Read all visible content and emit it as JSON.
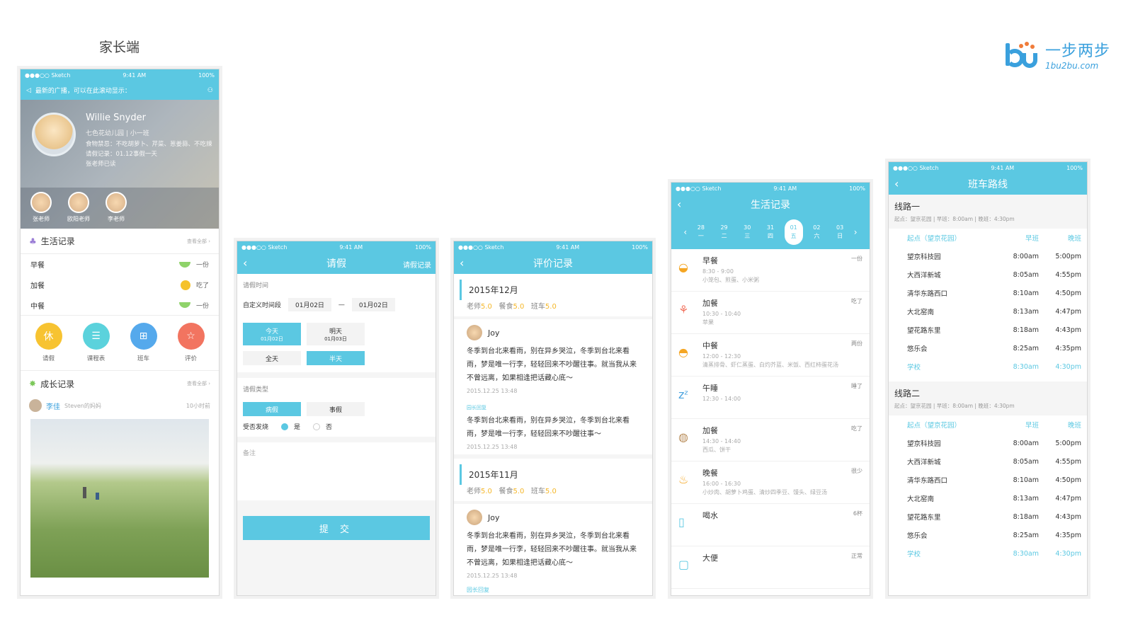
{
  "header": {
    "title": "家长端"
  },
  "logo": {
    "cn": "一步两步",
    "en": "1bu2bu.com"
  },
  "status": {
    "carrier": "●●●○○ Sketch",
    "time": "9:41 AM",
    "battery": "100%"
  },
  "p1": {
    "broadcast": "最新的广播，可以在此滚动显示：",
    "name": "Willie Snyder",
    "school": "七色花幼儿园  |  小一班",
    "info1": "食物禁忌：不吃胡萝卜、芹菜、葱姜蒜、不吃辣",
    "info2": "请假记录：01.12事假一天",
    "info3": "张老师已读",
    "teachers": [
      "张老师",
      "欧阳老师",
      "李老师"
    ],
    "life_title": "生活记录",
    "more": "查看全部",
    "meals": [
      {
        "name": "早餐",
        "status": "一份"
      },
      {
        "name": "加餐",
        "status": "吃了"
      },
      {
        "name": "中餐",
        "status": "一份"
      }
    ],
    "quick": [
      "请假",
      "课程表",
      "班车",
      "评价"
    ],
    "quick_icons": [
      "休",
      "☰",
      "⊞",
      "☆"
    ],
    "growth_title": "成长记录",
    "post_user": "李佳",
    "post_rel": "Steven的妈妈",
    "post_time": "10小时前"
  },
  "p2": {
    "title": "请假",
    "right": "请假记录",
    "time_label": "请假时间",
    "custom": "自定义时间段",
    "from": "01月02日",
    "dash": "—",
    "to": "01月02日",
    "today": "今天",
    "today_d": "01月02日",
    "tomorrow": "明天",
    "tomorrow_d": "01月03日",
    "full": "全天",
    "half": "半天",
    "type_label": "请假类型",
    "sick": "病假",
    "personal": "事假",
    "fever": "受否发烧",
    "yes": "是",
    "no": "否",
    "note": "备注",
    "submit": "提 交"
  },
  "p3": {
    "title": "评价记录",
    "blocks": [
      {
        "month": "2015年12月",
        "s1": "老师",
        "v1": "5.0",
        "s2": "餐食",
        "v2": "5.0",
        "s3": "班车",
        "v3": "5.0",
        "user": "Joy",
        "text": "冬季到台北来看雨，别在异乡哭泣，冬季到台北来看雨，梦是唯一行李，轻轻回来不吵醒往事。就当我从来不曾远离，如果相逢把话藏心底～",
        "date": "2015.12.25  13:48",
        "reply_label": "园长回复",
        "reply": "冬季到台北来看雨，别在异乡哭泣，冬季到台北来看雨，梦是唯一行李，轻轻回来不吵醒往事～",
        "reply_date": "2015.12.25  13:48"
      },
      {
        "month": "2015年11月",
        "s1": "老师",
        "v1": "5.0",
        "s2": "餐食",
        "v2": "5.0",
        "s3": "班车",
        "v3": "5.0",
        "user": "Joy",
        "text": "冬季到台北来看雨，别在异乡哭泣，冬季到台北来看雨，梦是唯一行李，轻轻回来不吵醒往事。就当我从来不曾远离，如果相逢把话藏心底～",
        "date": "2015.12.25  13:48",
        "reply_label": "园长回复"
      }
    ]
  },
  "p4": {
    "title": "生活记录",
    "days": [
      {
        "n": "28",
        "w": "一"
      },
      {
        "n": "29",
        "w": "二"
      },
      {
        "n": "30",
        "w": "三"
      },
      {
        "n": "31",
        "w": "四"
      },
      {
        "n": "01",
        "w": "五"
      },
      {
        "n": "02",
        "w": "六"
      },
      {
        "n": "03",
        "w": "日"
      }
    ],
    "items": [
      {
        "name": "早餐",
        "time": "8:30 - 9:00",
        "desc": "小笼包、煎蛋、小米粥",
        "status": "一份",
        "icon": "◒"
      },
      {
        "name": "加餐",
        "time": "10:30 - 10:40",
        "desc": "苹果",
        "status": "吃了",
        "icon": "⚘"
      },
      {
        "name": "中餐",
        "time": "12:00 - 12:30",
        "desc": "清蒸排骨、虾仁蒸蛋、白灼芥蓝、米饭、西红柿蛋花汤",
        "status": "两份",
        "icon": "◓"
      },
      {
        "name": "午睡",
        "time": "12:30 - 14:00",
        "desc": "",
        "status": "睡了",
        "icon": "zᶻ"
      },
      {
        "name": "加餐",
        "time": "14:30 - 14:40",
        "desc": "西瓜、饼干",
        "status": "吃了",
        "icon": "◍"
      },
      {
        "name": "晚餐",
        "time": "16:00 - 16:30",
        "desc": "小炒肉、胡萝卜鸡蛋、清炒四季豆、馒头、绿豆汤",
        "status": "很少",
        "icon": "♨"
      },
      {
        "name": "喝水",
        "time": "",
        "desc": "",
        "status": "6杯",
        "icon": "▯"
      },
      {
        "name": "大便",
        "time": "",
        "desc": "",
        "status": "正常",
        "icon": "▢"
      }
    ]
  },
  "p5": {
    "title": "班车路线",
    "routes": [
      {
        "name": "线路一",
        "desc": "起点：望京花园  |  早班：8:00am  |  晚班：4:30pm",
        "head": {
          "stop": "起点（望京花园）",
          "m": "早班",
          "e": "晚班"
        },
        "stops": [
          {
            "s": "望京科技园",
            "m": "8:00am",
            "e": "5:00pm"
          },
          {
            "s": "大西洋新城",
            "m": "8:05am",
            "e": "4:55pm"
          },
          {
            "s": "清华东路西口",
            "m": "8:10am",
            "e": "4:50pm"
          },
          {
            "s": "大北窑南",
            "m": "8:13am",
            "e": "4:47pm"
          },
          {
            "s": "望花路东里",
            "m": "8:18am",
            "e": "4:43pm"
          },
          {
            "s": "悠乐会",
            "m": "8:25am",
            "e": "4:35pm"
          },
          {
            "s": "学校",
            "m": "8:30am",
            "e": "4:30pm"
          }
        ]
      },
      {
        "name": "线路二",
        "desc": "起点：望京花园  |  早班：8:00am  |  晚班：4:30pm",
        "head": {
          "stop": "起点（望京花园）",
          "m": "早班",
          "e": "晚班"
        },
        "stops": [
          {
            "s": "望京科技园",
            "m": "8:00am",
            "e": "5:00pm"
          },
          {
            "s": "大西洋新城",
            "m": "8:05am",
            "e": "4:55pm"
          },
          {
            "s": "清华东路西口",
            "m": "8:10am",
            "e": "4:50pm"
          },
          {
            "s": "大北窑南",
            "m": "8:13am",
            "e": "4:47pm"
          },
          {
            "s": "望花路东里",
            "m": "8:18am",
            "e": "4:43pm"
          },
          {
            "s": "悠乐会",
            "m": "8:25am",
            "e": "4:35pm"
          },
          {
            "s": "学校",
            "m": "8:30am",
            "e": "4:30pm"
          }
        ]
      }
    ]
  }
}
